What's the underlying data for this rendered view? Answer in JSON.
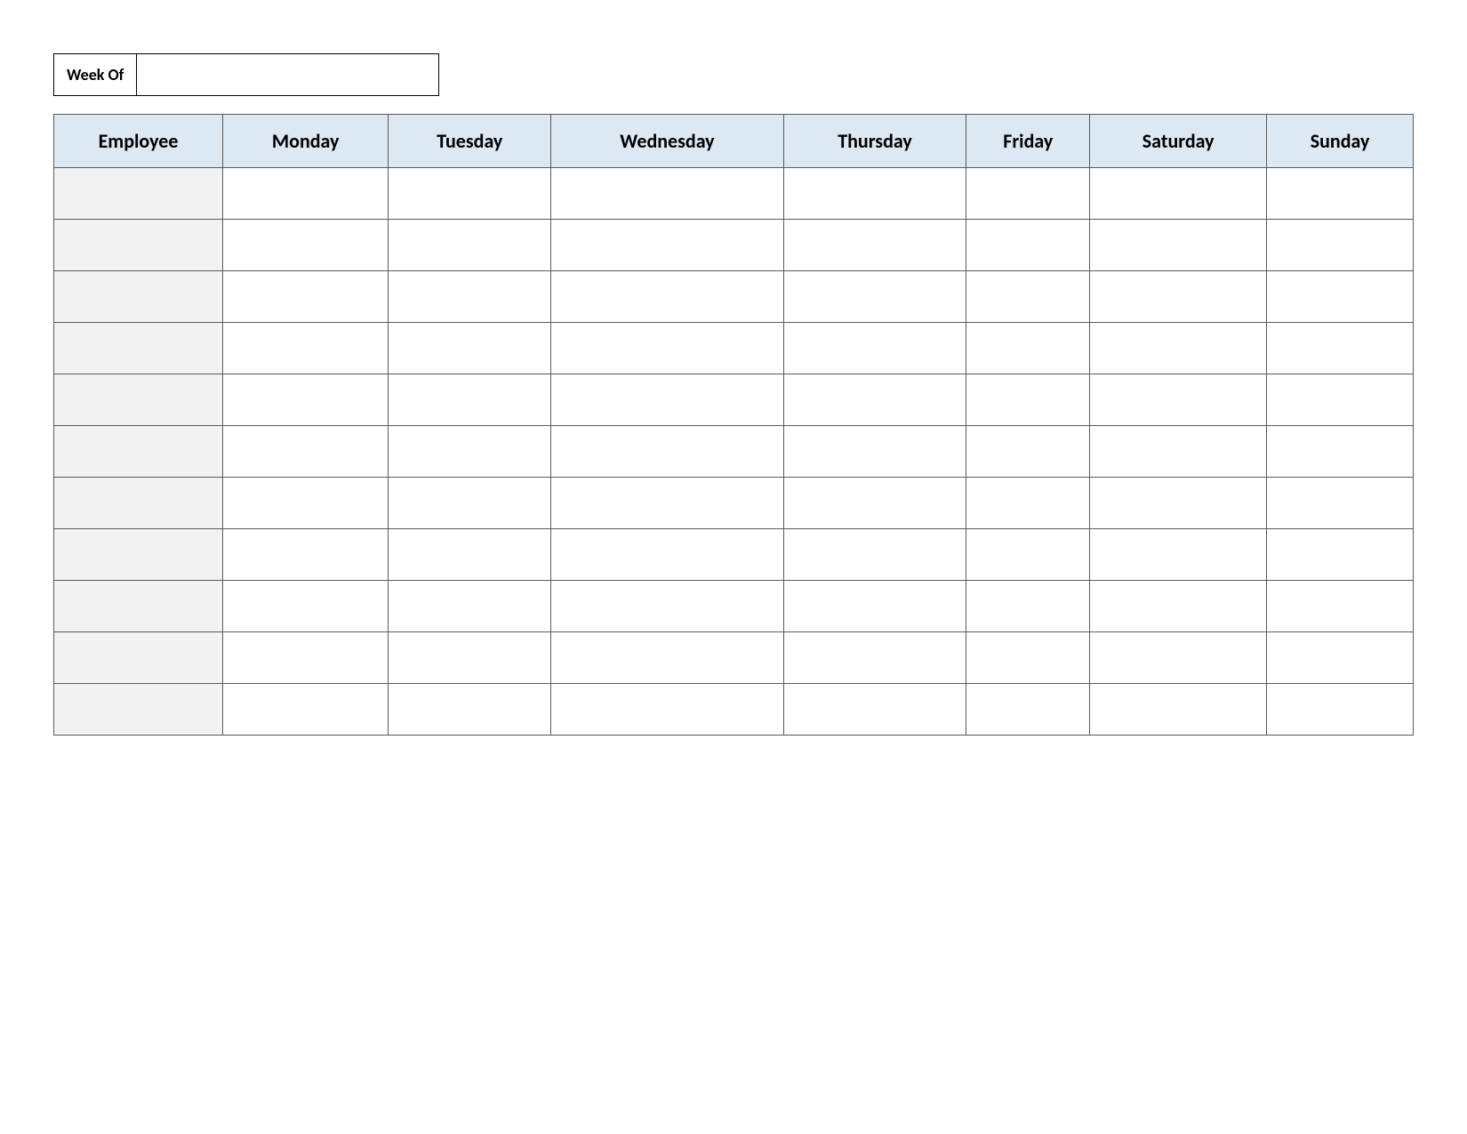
{
  "week_of": {
    "label": "Week Of",
    "value": ""
  },
  "table": {
    "headers": {
      "employee": "Employee",
      "days": [
        "Monday",
        "Tuesday",
        "Wednesday",
        "Thursday",
        "Friday",
        "Saturday",
        "Sunday"
      ]
    },
    "rows": [
      {
        "employee": "",
        "cells": [
          "",
          "",
          "",
          "",
          "",
          "",
          ""
        ]
      },
      {
        "employee": "",
        "cells": [
          "",
          "",
          "",
          "",
          "",
          "",
          ""
        ]
      },
      {
        "employee": "",
        "cells": [
          "",
          "",
          "",
          "",
          "",
          "",
          ""
        ]
      },
      {
        "employee": "",
        "cells": [
          "",
          "",
          "",
          "",
          "",
          "",
          ""
        ]
      },
      {
        "employee": "",
        "cells": [
          "",
          "",
          "",
          "",
          "",
          "",
          ""
        ]
      },
      {
        "employee": "",
        "cells": [
          "",
          "",
          "",
          "",
          "",
          "",
          ""
        ]
      },
      {
        "employee": "",
        "cells": [
          "",
          "",
          "",
          "",
          "",
          "",
          ""
        ]
      },
      {
        "employee": "",
        "cells": [
          "",
          "",
          "",
          "",
          "",
          "",
          ""
        ]
      },
      {
        "employee": "",
        "cells": [
          "",
          "",
          "",
          "",
          "",
          "",
          ""
        ]
      },
      {
        "employee": "",
        "cells": [
          "",
          "",
          "",
          "",
          "",
          "",
          ""
        ]
      },
      {
        "employee": "",
        "cells": [
          "",
          "",
          "",
          "",
          "",
          "",
          ""
        ]
      }
    ]
  }
}
